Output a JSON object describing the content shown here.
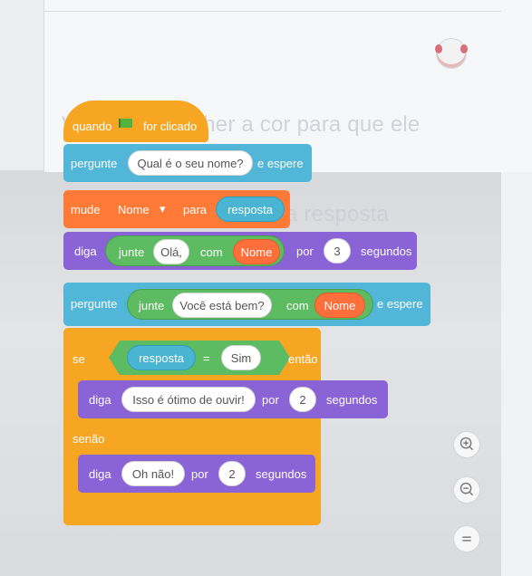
{
  "stage": {
    "speech_line_1": "Você vai escolher a cor para que ele",
    "speech_line_2": "se digitar sua resposta"
  },
  "script": {
    "when_flag": {
      "prefix": "quando",
      "suffix": "for clicado"
    },
    "ask_name": {
      "verb": "pergunte",
      "question": "Qual é o seu nome?",
      "suffix": "e espere"
    },
    "set_var": {
      "verb": "mude",
      "variable": "Nome",
      "to": "para",
      "value": "resposta"
    },
    "say_join_hello": {
      "verb": "diga",
      "join": "junte",
      "text": "Olá,",
      "with": "com",
      "variable": "Nome",
      "for": "por",
      "seconds": "3",
      "unit": "segundos"
    },
    "ask_join": {
      "verb": "pergunte",
      "join": "junte",
      "text": "Você está bem?",
      "with": "com",
      "variable": "Nome",
      "suffix": "e espere"
    },
    "if_block": {
      "if": "se",
      "left": "resposta",
      "op": "=",
      "right": "Sim",
      "then": "então",
      "else": "senão"
    },
    "say_great": {
      "verb": "diga",
      "text": "Isso é ótimo de ouvir!",
      "for": "por",
      "seconds": "2",
      "unit": "segundos"
    },
    "say_oh_no": {
      "verb": "diga",
      "text": "Oh não!",
      "for": "por",
      "seconds": "2",
      "unit": "segundos"
    }
  },
  "icons": {
    "zoom_in": "zoom-in-icon",
    "zoom_out": "zoom-out-icon",
    "reset_zoom": "reset-zoom-icon",
    "flag": "green-flag-icon"
  },
  "colors": {
    "events": "#f6a623",
    "sensing": "#52b6d8",
    "variables": "#ff7a36",
    "looks": "#8a63d7",
    "operators": "#5dbb61"
  }
}
